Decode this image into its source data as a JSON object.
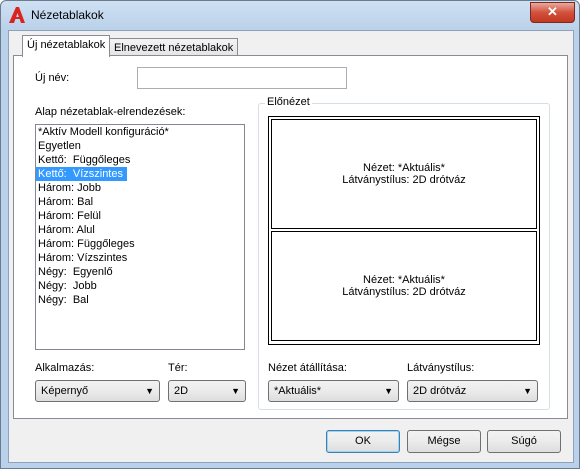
{
  "window": {
    "title": "Nézetablakok",
    "close_glyph": "✕"
  },
  "tabs": [
    "Új nézetablakok",
    "Elnevezett nézetablakok"
  ],
  "new_name": {
    "label": "Új név:",
    "value": ""
  },
  "layouts": {
    "label": "Alap nézetablak-elrendezések:",
    "items": [
      "*Aktív Modell konfiguráció*",
      "Egyetlen",
      "Kettő:  Függőleges",
      "Kettő:  Vízszintes",
      "Három: Jobb",
      "Három: Bal",
      "Három: Felül",
      "Három: Alul",
      "Három: Függőleges",
      "Három: Vízszintes",
      "Négy:  Egyenlő",
      "Négy:  Jobb",
      "Négy:  Bal"
    ],
    "selected_index": 3
  },
  "preview": {
    "label": "Előnézet",
    "viewports": [
      {
        "view": "Nézet: *Aktuális*",
        "style": "Látványstílus: 2D drótváz"
      },
      {
        "view": "Nézet: *Aktuális*",
        "style": "Látványstílus: 2D drótváz"
      }
    ]
  },
  "apply": {
    "label": "Alkalmazás:",
    "value": "Képernyő"
  },
  "space": {
    "label": "Tér:",
    "value": "2D"
  },
  "change_view": {
    "label": "Nézet átállítása:",
    "value": "*Aktuális*"
  },
  "visual_style": {
    "label": "Látványstílus:",
    "value": "2D drótváz"
  },
  "buttons": {
    "ok": "OK",
    "cancel": "Mégse",
    "help": "Súgó"
  }
}
